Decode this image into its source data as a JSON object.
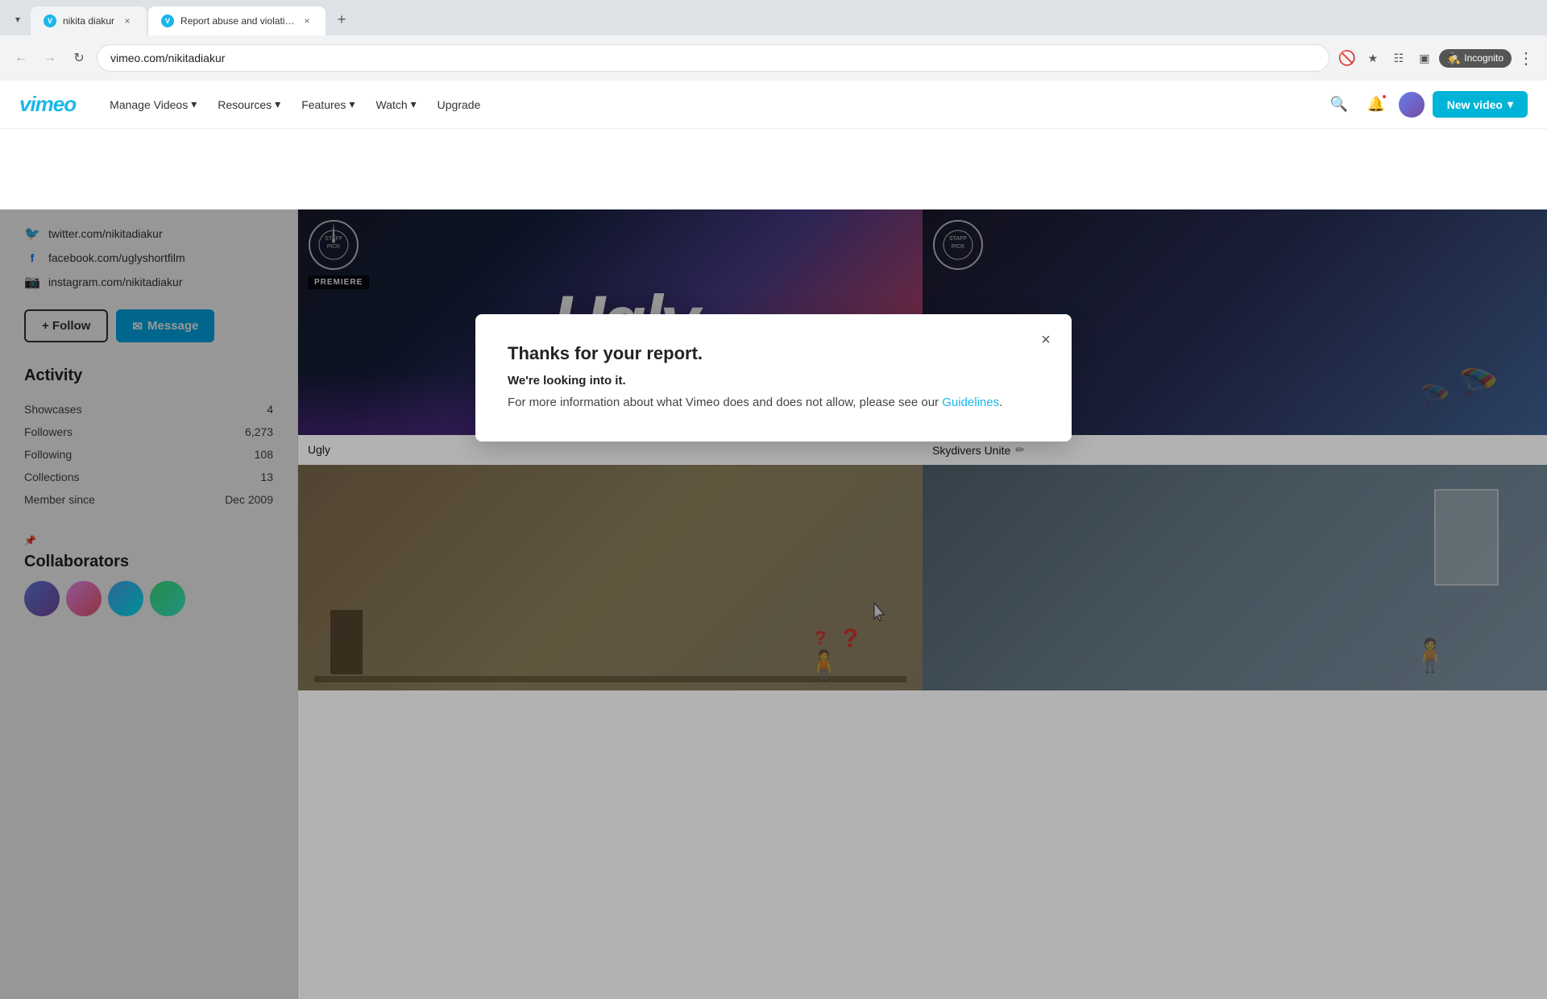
{
  "browser": {
    "tabs": [
      {
        "id": "tab1",
        "title": "nikita diakur",
        "url": "vimeo.com/nikitadiakur",
        "active": false,
        "favicon": "vimeo"
      },
      {
        "id": "tab2",
        "title": "Report abuse and violations –",
        "url": "vimeo.com/nikitadiakur",
        "active": true,
        "favicon": "vimeo"
      }
    ],
    "url": "vimeo.com/nikitadiakur",
    "incognito_label": "Incognito"
  },
  "header": {
    "logo": "vimeo",
    "nav_items": [
      {
        "label": "Manage Videos",
        "has_arrow": true
      },
      {
        "label": "Resources",
        "has_arrow": true
      },
      {
        "label": "Features",
        "has_arrow": true
      },
      {
        "label": "Watch",
        "has_arrow": true
      },
      {
        "label": "Upgrade",
        "has_arrow": false
      }
    ],
    "new_video_label": "New video"
  },
  "sidebar": {
    "social_links": [
      {
        "platform": "twitter",
        "url": "twitter.com/nikitadiakur"
      },
      {
        "platform": "facebook",
        "url": "facebook.com/uglyshortfilm"
      },
      {
        "platform": "instagram",
        "url": "instagram.com/nikitadiakur"
      }
    ],
    "follow_button": "+ Follow",
    "message_button": "Message",
    "activity": {
      "title": "Activity",
      "items": [
        {
          "label": "Showcases",
          "value": "4"
        },
        {
          "label": "Followers",
          "value": "6,273"
        },
        {
          "label": "Following",
          "value": "108"
        },
        {
          "label": "Collections",
          "value": "13"
        },
        {
          "label": "Member since",
          "value": "Dec 2009"
        }
      ]
    },
    "collaborators": {
      "title": "Collaborators",
      "count": 4
    }
  },
  "videos": [
    {
      "id": "ugly",
      "title": "Ugly",
      "has_staff_pick": true,
      "has_premiere": true,
      "thumb_type": "ugly"
    },
    {
      "id": "skydivers",
      "title": "Skydivers Unite",
      "has_staff_pick": true,
      "has_edit_icon": true,
      "thumb_type": "skydivers"
    },
    {
      "id": "office",
      "title": "",
      "has_question_marks": true,
      "thumb_type": "office"
    },
    {
      "id": "room",
      "title": "",
      "thumb_type": "room"
    }
  ],
  "modal": {
    "title": "Thanks for your report.",
    "subtitle": "We're looking into it.",
    "body_text": "For more information about what Vimeo does and does not allow, please see our ",
    "link_text": "Guidelines",
    "link_url": "#",
    "body_suffix": ".",
    "close_label": "×"
  }
}
